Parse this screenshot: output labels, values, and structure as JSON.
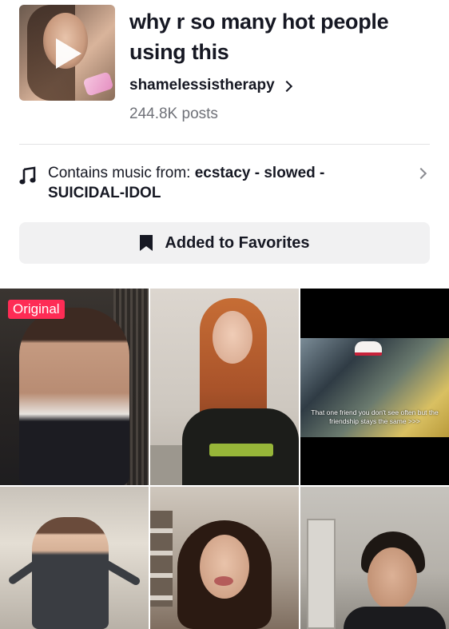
{
  "sound": {
    "title": "why r so many hot people using this",
    "author": "shamelessistherapy",
    "posts": "244.8K posts",
    "music_label": "Contains music from: ",
    "music_song": "ecstacy - slowed - SUICIDAL-IDOL",
    "favorite_label": "Added to Favorites"
  },
  "grid": {
    "original_badge": "Original",
    "clip_caption": "That one friend you don't see often but the friendship stays the same >>>"
  },
  "colors": {
    "badge": "#fe2c55",
    "text": "#161823",
    "muted": "#6f7178",
    "button_bg": "#f1f1f2"
  },
  "icons": [
    "play-icon",
    "chevron-right-icon",
    "music-note-icon",
    "bookmark-icon"
  ]
}
